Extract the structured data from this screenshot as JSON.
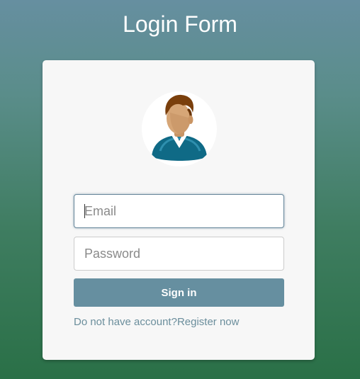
{
  "page": {
    "title": "Login Form"
  },
  "form": {
    "avatar_icon": "user-avatar-icon",
    "email": {
      "value": "",
      "placeholder": "Email"
    },
    "password": {
      "value": "",
      "placeholder": "Password"
    },
    "signin_label": "Sign in",
    "register_prompt": "Do not have account?",
    "register_link": "Register now"
  },
  "colors": {
    "accent": "#668fa0",
    "link": "#6b8e9c",
    "card_background": "#f7f7f7",
    "background_top": "#668fa0",
    "background_bottom": "#2a7047"
  }
}
